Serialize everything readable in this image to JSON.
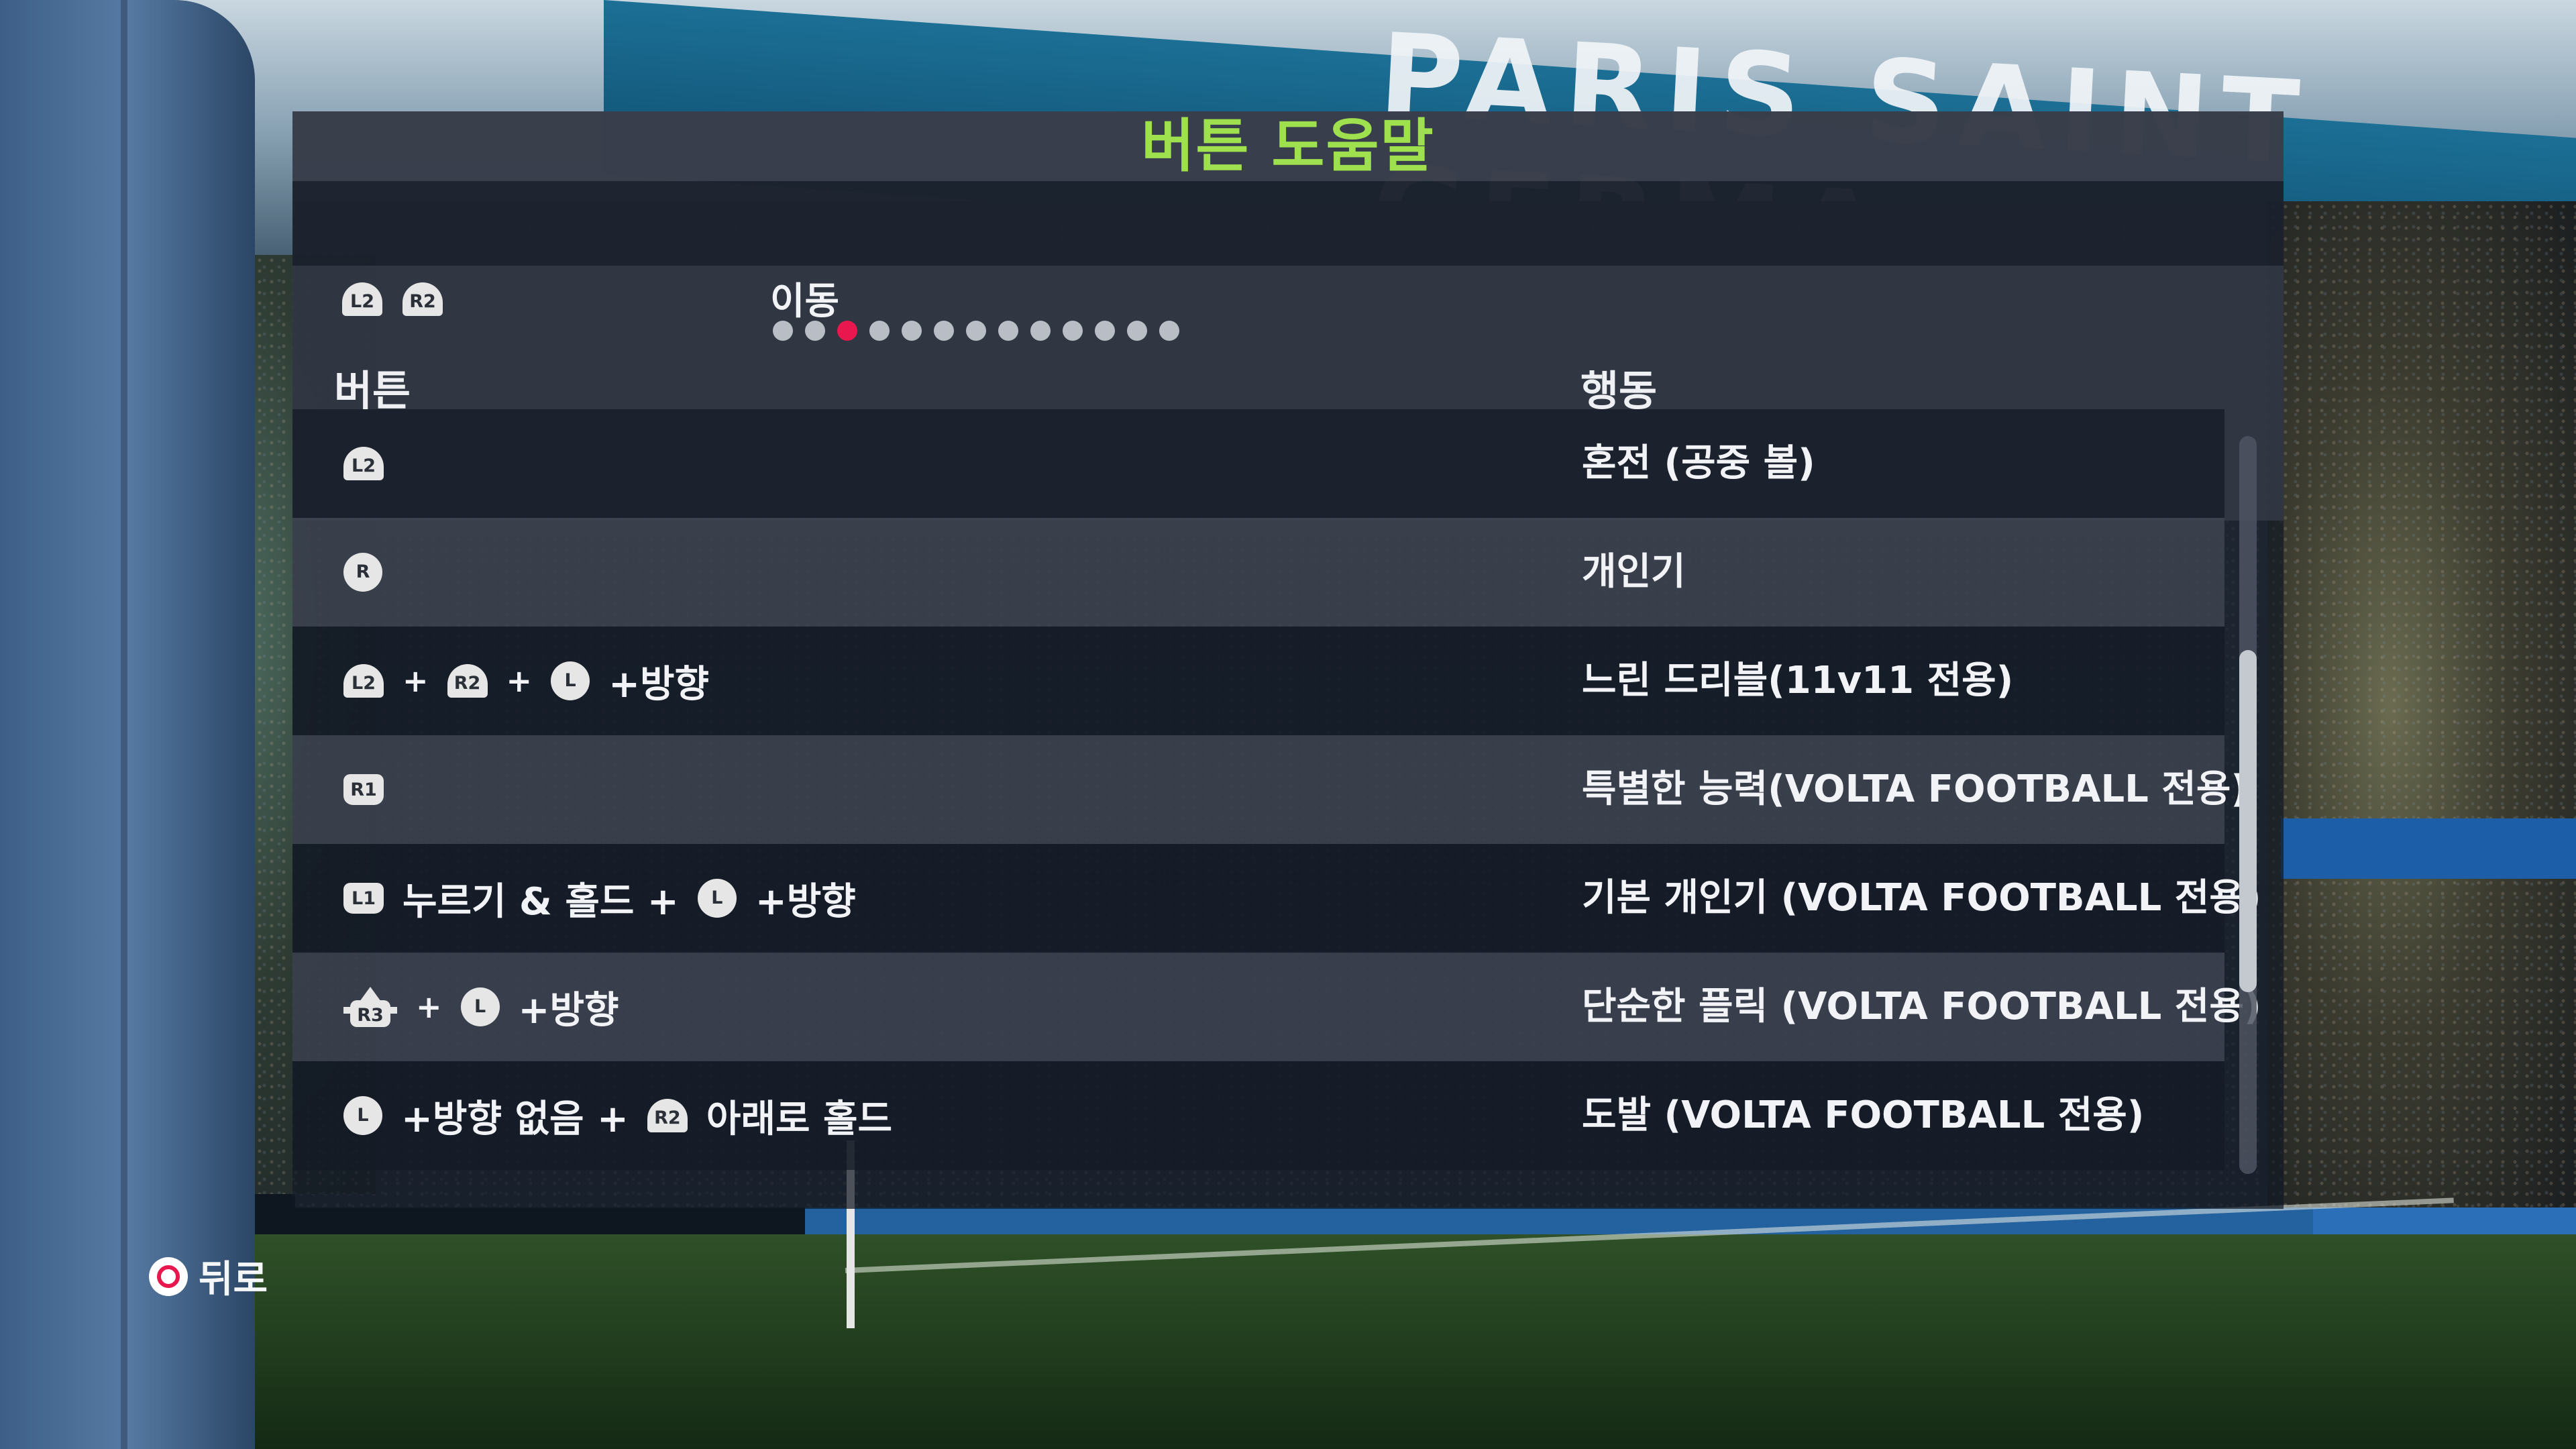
{
  "panel": {
    "title": "버튼 도움말",
    "nav": {
      "prev_key": "L2",
      "next_key": "R2",
      "label": "이동",
      "page_count": 13,
      "active_page": 3
    },
    "columns": {
      "button": "버튼",
      "action": "행동"
    },
    "rows": [
      {
        "keys": [
          "L2"
        ],
        "action": "혼전 (공중 볼)"
      },
      {
        "keys": [
          "R"
        ],
        "action": "개인기"
      },
      {
        "keys": [
          "L2",
          "+",
          "R2",
          "+",
          "L",
          "+방향"
        ],
        "action": "느린 드리블(11v11 전용)"
      },
      {
        "keys": [
          "R1"
        ],
        "action": "특별한 능력(VOLTA FOOTBALL 전용)"
      },
      {
        "keys": [
          "L1",
          "누르기 & 홀드 +",
          "L",
          "+방향"
        ],
        "action": "기본 개인기 (VOLTA FOOTBALL 전용)"
      },
      {
        "keys": [
          "R3",
          "+",
          "L",
          "+방향"
        ],
        "action": "단순한 플릭 (VOLTA FOOTBALL 전용)"
      },
      {
        "keys": [
          "L",
          "+방향 없음 +",
          "R2",
          "아래로 홀드"
        ],
        "action": "도발 (VOLTA FOOTBALL 전용)"
      }
    ],
    "scroll_position": 0.54
  },
  "footer": {
    "back_label": "뒤로",
    "back_button": "circle-button"
  },
  "background": {
    "stadium_banner": "PARIS SAINT GERMA"
  },
  "colors": {
    "title": "#9fe04f",
    "active_dot": "#e8174d",
    "text": "#f1f3f6"
  }
}
